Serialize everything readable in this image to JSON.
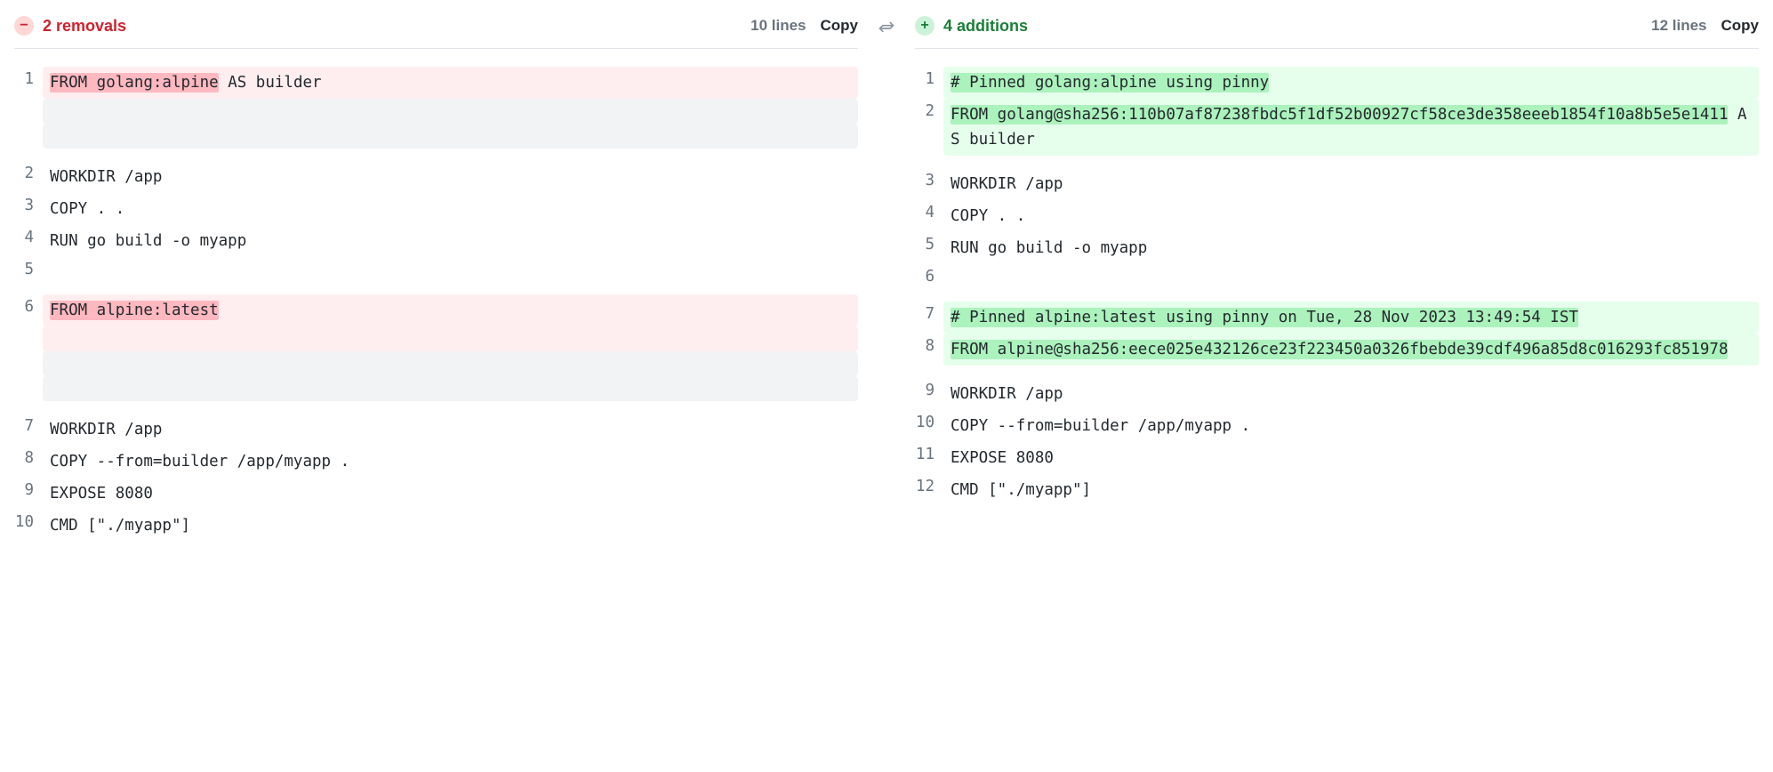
{
  "left": {
    "badge": "−",
    "change_label": "2 removals",
    "line_count": "10 lines",
    "copy": "Copy",
    "rows": [
      {
        "n": "1",
        "bg": "red",
        "segments": [
          {
            "t": "FROM golang:alpine",
            "hl": "red"
          },
          {
            "t": " AS builder"
          }
        ]
      },
      {
        "n": "",
        "bg": "grey",
        "segments": []
      },
      {
        "n": "",
        "bg": "grey",
        "segments": []
      },
      {
        "gap": true
      },
      {
        "n": "2",
        "segments": [
          {
            "t": "WORKDIR /app"
          }
        ]
      },
      {
        "n": "3",
        "segments": [
          {
            "t": "COPY . ."
          }
        ]
      },
      {
        "n": "4",
        "segments": [
          {
            "t": "RUN go build -o myapp"
          }
        ]
      },
      {
        "n": "5",
        "segments": []
      },
      {
        "gap": true
      },
      {
        "n": "6",
        "bg": "red",
        "segments": [
          {
            "t": "FROM alpine:latest",
            "hl": "red"
          }
        ]
      },
      {
        "n": "",
        "bg": "red",
        "segments": []
      },
      {
        "n": "",
        "bg": "grey",
        "segments": []
      },
      {
        "n": "",
        "bg": "grey",
        "segments": []
      },
      {
        "gap": true
      },
      {
        "n": "7",
        "segments": [
          {
            "t": "WORKDIR /app"
          }
        ]
      },
      {
        "n": "8",
        "segments": [
          {
            "t": "COPY --from=builder /app/myapp ."
          }
        ]
      },
      {
        "n": "9",
        "segments": [
          {
            "t": "EXPOSE 8080"
          }
        ]
      },
      {
        "n": "10",
        "segments": [
          {
            "t": "CMD [\"./myapp\"]"
          }
        ]
      }
    ]
  },
  "right": {
    "badge": "+",
    "change_label": "4 additions",
    "line_count": "12 lines",
    "copy": "Copy",
    "rows": [
      {
        "n": "1",
        "bg": "green",
        "segments": [
          {
            "t": "# Pinned golang:alpine using pinny",
            "hl": "green"
          }
        ]
      },
      {
        "n": "2",
        "bg": "green",
        "segments": [
          {
            "t": "FROM golang@sha256:110b07af87238fbdc5f1df52b00927cf58ce3de358eeeb1854f10a8b5e5e1411",
            "hl": "green"
          },
          {
            "t": " AS builder"
          }
        ]
      },
      {
        "gap": true
      },
      {
        "n": "3",
        "segments": [
          {
            "t": "WORKDIR /app"
          }
        ]
      },
      {
        "n": "4",
        "segments": [
          {
            "t": "COPY . ."
          }
        ]
      },
      {
        "n": "5",
        "segments": [
          {
            "t": "RUN go build -o myapp"
          }
        ]
      },
      {
        "n": "6",
        "segments": []
      },
      {
        "gap": true
      },
      {
        "n": "7",
        "bg": "green",
        "segments": [
          {
            "t": "# Pinned alpine:latest using pinny on Tue, 28 Nov 2023 13:49:54 IST",
            "hl": "green"
          }
        ]
      },
      {
        "n": "8",
        "bg": "green",
        "segments": [
          {
            "t": "FROM alpine@sha256:eece025e432126ce23f223450a0326fbebde39cdf496a85d8c016293fc851978",
            "hl": "green"
          }
        ]
      },
      {
        "gap": true
      },
      {
        "n": "9",
        "segments": [
          {
            "t": "WORKDIR /app"
          }
        ]
      },
      {
        "n": "10",
        "segments": [
          {
            "t": "COPY --from=builder /app/myapp ."
          }
        ]
      },
      {
        "n": "11",
        "segments": [
          {
            "t": "EXPOSE 8080"
          }
        ]
      },
      {
        "n": "12",
        "segments": [
          {
            "t": "CMD [\"./myapp\"]"
          }
        ]
      }
    ]
  }
}
